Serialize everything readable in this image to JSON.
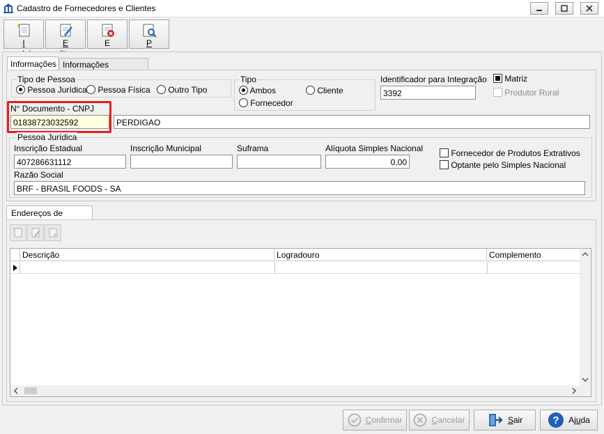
{
  "window": {
    "title": "Cadastro de Fornecedores e Clientes"
  },
  "toolbar": {
    "incluir": "Incluir",
    "incluir_u": "I",
    "incluir_rest": "ncluir",
    "editar": "Editar",
    "editar_u": "E",
    "editar_rest": "ditar",
    "excluir": "Excluir",
    "excluir_u": "x",
    "excluir_pre": "E",
    "excluir_rest": "cluir",
    "procurar": "Procurar",
    "procurar_u": "P",
    "procurar_rest": "rocurar"
  },
  "tabs": {
    "informacoes": "Informações",
    "adicionais": "Informações Adicionais"
  },
  "tipo_pessoa": {
    "legend": "Tipo de Pessoa",
    "options": [
      "Pessoa Jurídica",
      "Pessoa Física",
      "Outro Tipo"
    ],
    "selected": "Pessoa Jurídica"
  },
  "tipo": {
    "legend": "Tipo",
    "ambos": "Ambos",
    "cliente": "Cliente",
    "fornecedor": "Fornecedor",
    "selected": "Ambos"
  },
  "identificador": {
    "label": "Identificador para Integração",
    "value": "3392"
  },
  "matriz": {
    "label": "Matriz",
    "checked": true
  },
  "produtor_rural": {
    "label": "Produtor Rural",
    "checked": false
  },
  "documento": {
    "label": "N° Documento - CNPJ",
    "value": "01838723032592",
    "name_value": "PERDIGAO"
  },
  "pessoa_juridica": {
    "legend": "Pessoa Jurídica",
    "inscricao_estadual": {
      "label": "Inscrição Estadual",
      "value": "407286631112"
    },
    "inscricao_municipal": {
      "label": "Inscrição Municipal",
      "value": ""
    },
    "suframa": {
      "label": "Suframa",
      "value": ""
    },
    "aliquota": {
      "label": "Alíquota Simples Nacional",
      "value": "0,00"
    },
    "extrativos": {
      "label": "Fornecedor de Produtos Extrativos",
      "checked": false
    },
    "simples": {
      "label": "Optante pelo Simples Nacional",
      "checked": false
    },
    "razao_social": {
      "label": "Razão Social",
      "value": "BRF - BRASIL FOODS - SA"
    }
  },
  "enderecos": {
    "tab": "Endereços de Entrega",
    "columns": [
      "Descrição",
      "Logradouro",
      "Complemento"
    ]
  },
  "footer": {
    "confirmar": "Confirmar",
    "confirmar_u": "C",
    "confirmar_rest": "onfirmar",
    "cancelar": "Cancelar",
    "cancelar_u": "C",
    "cancelar_rest": "ancelar",
    "sair": "Sair",
    "sair_u": "S",
    "sair_rest": "air",
    "ajuda": "Ajuda",
    "ajuda_pre": "Aj",
    "ajuda_u": "u",
    "ajuda_rest": "da"
  },
  "colors": {
    "highlight_border": "#e02020",
    "cnpj_bg": "#ffffe1",
    "help_blue": "#1e62b8"
  }
}
